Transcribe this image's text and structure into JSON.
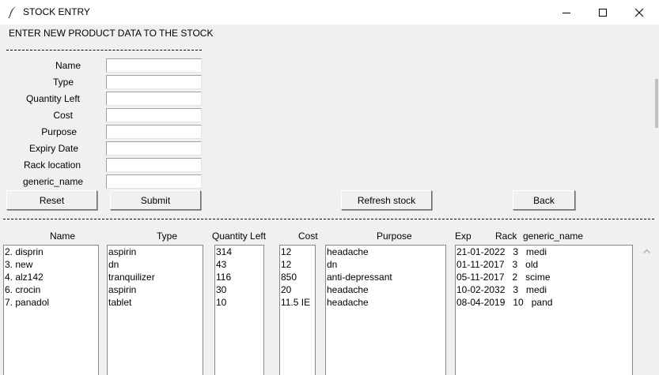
{
  "window": {
    "title": "STOCK ENTRY"
  },
  "form": {
    "heading": "ENTER NEW PRODUCT DATA TO THE STOCK",
    "fields": [
      {
        "label": "Name",
        "value": ""
      },
      {
        "label": "Type",
        "value": ""
      },
      {
        "label": "Quantity Left",
        "value": ""
      },
      {
        "label": "Cost",
        "value": ""
      },
      {
        "label": "Purpose",
        "value": ""
      },
      {
        "label": "Expiry Date",
        "value": ""
      },
      {
        "label": "Rack location",
        "value": ""
      },
      {
        "label": "generic_name",
        "value": ""
      }
    ]
  },
  "buttons": {
    "reset": "Reset",
    "submit": "Submit",
    "refresh": "Refresh stock",
    "back": "Back"
  },
  "table": {
    "headers": {
      "name": "Name",
      "type": "Type",
      "quantity": "Quantity Left",
      "cost": "Cost",
      "purpose": "Purpose",
      "exp": "Exp",
      "rack": "Rack",
      "generic": "generic_name"
    },
    "name_list": [
      "2. disprin",
      "3. new",
      "4. alz142",
      "6. crocin",
      "7. panadol"
    ],
    "type_list": [
      "aspirin",
      "dn",
      "tranquilizer",
      "aspirin",
      "tablet"
    ],
    "quantity_list": [
      "314",
      "43",
      "116",
      "30",
      "10"
    ],
    "cost_list": [
      "12",
      "12",
      "850",
      "20",
      "11.5 IE"
    ],
    "purpose_list": [
      "headache",
      "dn",
      "anti-depressant",
      "headache",
      "headache"
    ],
    "exp_rack_generic_list": [
      "21-01-2022   3   medi",
      "01-11-2017   3   old",
      "05-11-2017   2   scime",
      "10-02-2032   3   medi",
      "08-04-2019   10   pand"
    ]
  }
}
